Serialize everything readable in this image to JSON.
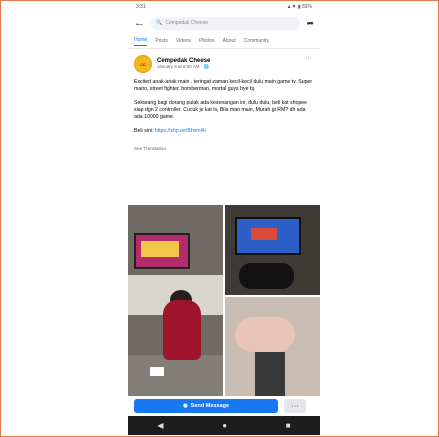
{
  "status": {
    "time": "3:31",
    "icons": "▲▼ ▮ 83%"
  },
  "search": {
    "text": "Cempedak Cheese"
  },
  "tabs": [
    "Home",
    "Posts",
    "Videos",
    "Photos",
    "About",
    "Community"
  ],
  "post": {
    "page_name": "Cempedak Cheese",
    "meta": "January 8 at 8:00 AM · 🌐",
    "avatar_text": "CC",
    "paragraphs": [
      "Excited anak-anak main . teringat zaman kecil-kecil dulu main game tv. Super mario, street fighter, bomberman, mortal guys bye bj.",
      "Sekarang bagi dorang pulak ada kesenangan ini, dulu dulu, beli kat shopee siap dgn 2 controller. Cucuk je kat tv, Bila mao main, Murah gi RM? dh ada ada 10000 game."
    ],
    "link_prefix": "Beli sini:",
    "link": "https://shp.ee/Bhvml4i",
    "see_translation": "See Translation"
  },
  "cta": {
    "send_label": "Send Message",
    "more_label": "···"
  },
  "nav": {
    "back": "◀",
    "home": "●",
    "recent": "■"
  },
  "colors": {
    "accent": "#1877f2",
    "border": "#e07a4a"
  }
}
